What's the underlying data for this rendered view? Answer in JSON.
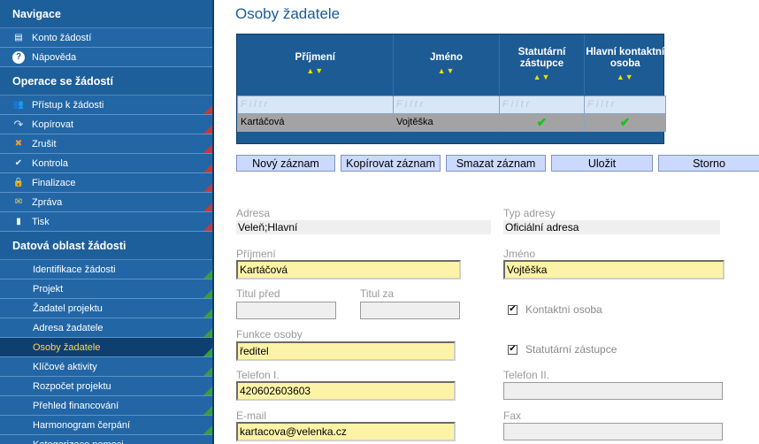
{
  "sidebar": {
    "sections": [
      {
        "title": "Navigace",
        "items": [
          {
            "label": "Konto žádostí",
            "icon": "account-icon",
            "glyph": "▤"
          },
          {
            "label": "Nápověda",
            "icon": "help-icon",
            "glyph": "?"
          }
        ]
      },
      {
        "title": "Operace se žádostí",
        "items": [
          {
            "label": "Přístup k žádosti",
            "icon": "users-icon",
            "glyph": "👥"
          },
          {
            "label": "Kopírovat",
            "icon": "copy-arrow-icon",
            "glyph": "↷"
          },
          {
            "label": "Zrušit",
            "icon": "cancel-icon",
            "glyph": "✖"
          },
          {
            "label": "Kontrola",
            "icon": "checkmark-icon",
            "glyph": "✔"
          },
          {
            "label": "Finalizace",
            "icon": "lock-icon",
            "glyph": "🔒"
          },
          {
            "label": "Zpráva",
            "icon": "mail-icon",
            "glyph": "✉"
          },
          {
            "label": "Tisk",
            "icon": "print-icon",
            "glyph": "▮"
          }
        ]
      },
      {
        "title": "Datová oblast žádosti",
        "items": [
          {
            "label": "Identifikace žádosti"
          },
          {
            "label": "Projekt"
          },
          {
            "label": "Žadatel projektu"
          },
          {
            "label": "Adresa žadatele"
          },
          {
            "label": "Osoby žadatele",
            "active": true
          },
          {
            "label": "Klíčové aktivity"
          },
          {
            "label": "Rozpočet projektu"
          },
          {
            "label": "Přehled financování"
          },
          {
            "label": "Harmonogram čerpání"
          },
          {
            "label": "Kategorizace pomoci"
          }
        ]
      }
    ]
  },
  "page": {
    "title": "Osoby žadatele"
  },
  "grid": {
    "columns": [
      "Příjmení",
      "Jméno",
      "Statutární zástupce",
      "Hlavní kontaktní osoba"
    ],
    "filter_placeholder": "Filtr",
    "rows": [
      {
        "prijmeni": "Kartáčová",
        "jmeno": "Vojtěška",
        "statutarni": "✔",
        "kontaktni": "✔"
      }
    ]
  },
  "toolbar": {
    "new": "Nový záznam",
    "copy": "Kopírovat záznam",
    "delete": "Smazat záznam",
    "save": "Uložit",
    "cancel": "Storno"
  },
  "form": {
    "adresa_label": "Adresa",
    "adresa_value": "Veleň;Hlavní",
    "typ_adresy_label": "Typ adresy",
    "typ_adresy_value": "Oficiální adresa",
    "prijmeni_label": "Příjmení",
    "prijmeni_value": "Kartáčová",
    "jmeno_label": "Jméno",
    "jmeno_value": "Vojtěška",
    "titul_pred_label": "Titul před",
    "titul_pred_value": "",
    "titul_za_label": "Titul za",
    "titul_za_value": "",
    "kontaktni_label": "Kontaktní osoba",
    "funkce_label": "Funkce osoby",
    "funkce_value": "ředitel",
    "statutarni_label": "Statutární zástupce",
    "telefon1_label": "Telefon I.",
    "telefon1_value": "420602603603",
    "telefon2_label": "Telefon II.",
    "telefon2_value": "",
    "email_label": "E-mail",
    "email_value": "kartacova@velenka.cz",
    "fax_label": "Fax",
    "fax_value": ""
  },
  "colors": {
    "sidebar": "#1c5b94",
    "required_field": "#fdf3a7",
    "button": "#ccd9ff",
    "accent": "#1a5a96"
  }
}
